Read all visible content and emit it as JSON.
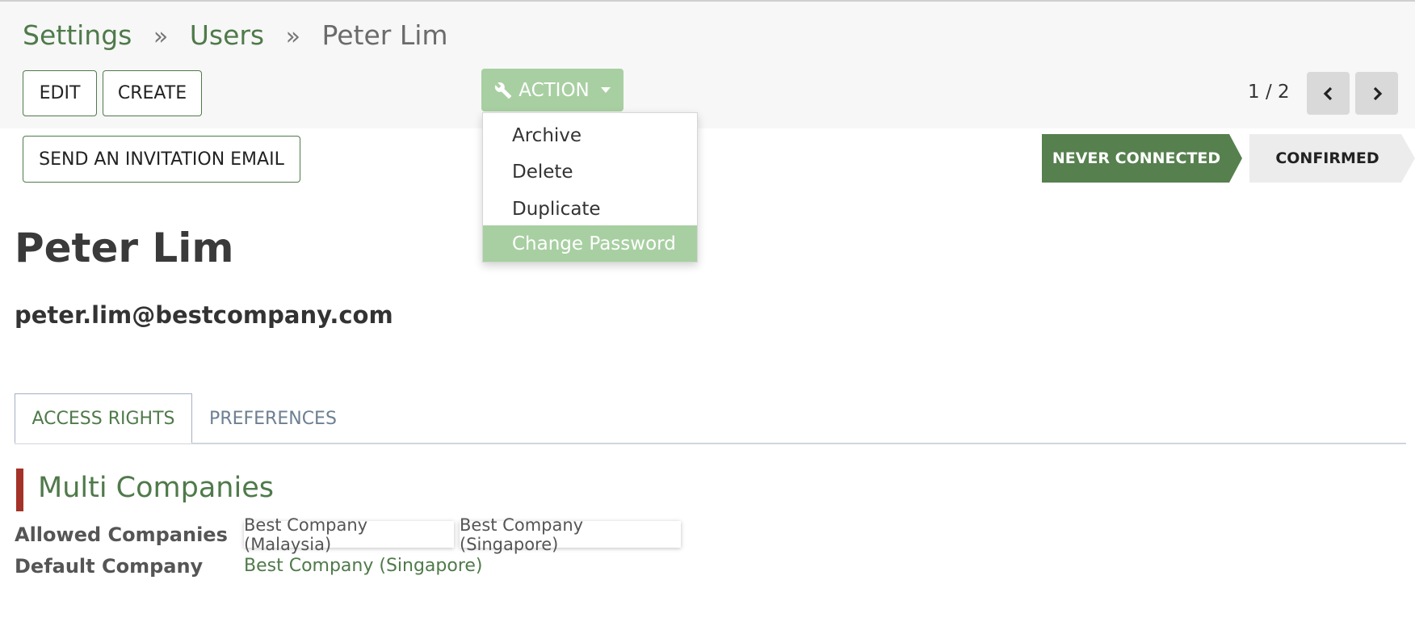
{
  "breadcrumb": {
    "items": [
      "Settings",
      "Users"
    ],
    "current": "Peter Lim"
  },
  "toolbar": {
    "edit_label": "EDIT",
    "create_label": "CREATE",
    "action_label": "ACTION"
  },
  "action_menu": {
    "items": [
      "Archive",
      "Delete",
      "Duplicate",
      "Change Password"
    ],
    "highlighted": "Change Password"
  },
  "pager": {
    "value": "1 / 2"
  },
  "invite_button": "SEND AN INVITATION EMAIL",
  "statusbar": {
    "states": [
      "NEVER CONNECTED",
      "CONFIRMED"
    ],
    "active": "NEVER CONNECTED"
  },
  "record": {
    "name": "Peter Lim",
    "email": "peter.lim@bestcompany.com"
  },
  "tabs": [
    "ACCESS RIGHTS",
    "PREFERENCES"
  ],
  "section": {
    "title": "Multi Companies",
    "allowed_label": "Allowed Companies",
    "allowed_companies": [
      "Best Company (Malaysia)",
      "Best Company (Singapore)"
    ],
    "default_label": "Default Company",
    "default_company": "Best Company (Singapore)"
  },
  "colors": {
    "brand_green": "#4f7a4a",
    "action_green": "#a8cfa2",
    "status_active": "#56804e",
    "section_accent": "#a43228"
  },
  "icons": [
    "wrench-icon",
    "chevron-left-icon",
    "chevron-right-icon",
    "double-chevron-right-icon"
  ]
}
